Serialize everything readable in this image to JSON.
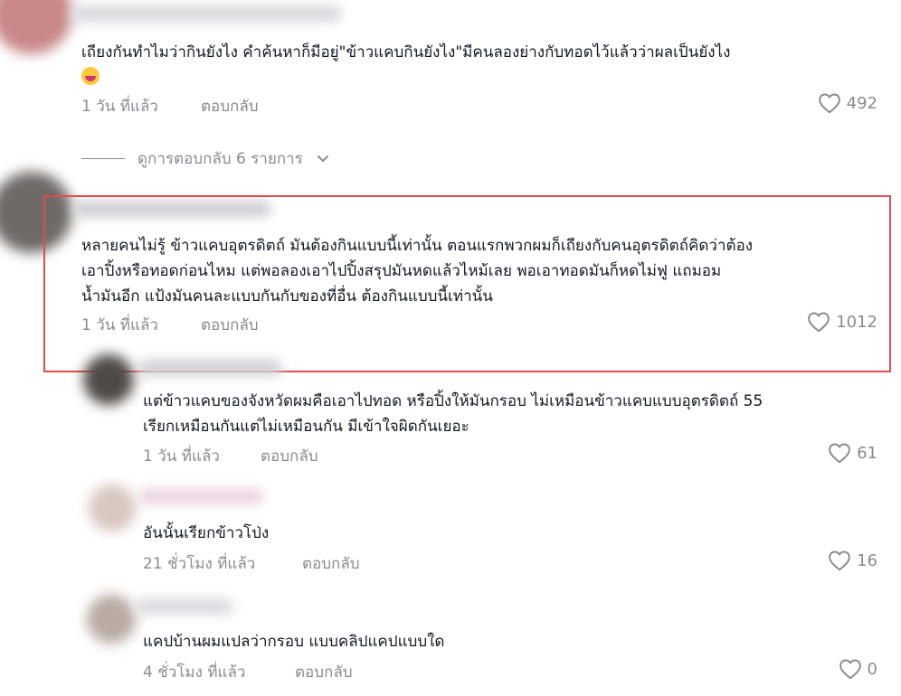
{
  "comments": [
    {
      "text_lines": [
        "เถียงกันทำไมว่ากินยังไง คำค้นหาก็มีอยู่\"ข้าวแคบกินยังไง\"มีคนลองย่างกับทอดไว้แล้วว่าผลเป็นยังไง"
      ],
      "time": "1 วัน ที่แล้ว",
      "reply_label": "ตอบกลับ",
      "likes": "492",
      "emoji": "grinning-face-emoji"
    },
    {
      "text_lines": [
        "หลายคนไม่รู้ ข้าวแคบอุตรดิตถ์ มันต้องกินแบบนี้เท่านั้น ตอนแรกพวกผมก็เถียงกับคนอุตรดิตถ์คิดว่าต้อง",
        "เอาปิ้งหรือทอดก่อนไหม แต่พอลองเอาไปปิ้งสรุปมันหดแล้วไหม้เลย พอเอาทอดมันก็หดไม่ฟู แถมอม",
        "น้ำมันอีก แป้งมันคนละแบบกันกับของที่อื่น ต้องกินแบบนี้เท่านั้น"
      ],
      "time": "1 วัน ที่แล้ว",
      "reply_label": "ตอบกลับ",
      "likes": "1012"
    },
    {
      "text_lines": [
        "แต่ข้าวแคบของจังหวัดผมคือเอาไปทอด หรือปิ้งให้มันกรอบ ไม่เหมือนข้าวแคบแบบอุตรดิตถ์ 55",
        "เรียกเหมือนกันแต่ไม่เหมือนกัน มีเข้าใจผิดกันเยอะ"
      ],
      "time": "1 วัน ที่แล้ว",
      "reply_label": "ตอบกลับ",
      "likes": "61"
    },
    {
      "text_lines": [
        "อันนั้นเรียกข้าวโป่ง"
      ],
      "time": "21 ชั่วโมง ที่แล้ว",
      "reply_label": "ตอบกลับ",
      "likes": "16"
    },
    {
      "text_lines": [
        "แคปบ้านผมแปลว่ากรอบ แบบคลิปแคปแบบใด"
      ],
      "time": "4 ชั่วโมง ที่แล้ว",
      "reply_label": "ตอบกลับ",
      "likes": "0"
    }
  ],
  "view_replies": {
    "label": "ดูการตอบกลับ 6 รายการ",
    "icon": "chevron-down-icon"
  },
  "colors": {
    "highlight": "#e04b4b",
    "muted": "#8a8b91",
    "text": "#161823"
  }
}
